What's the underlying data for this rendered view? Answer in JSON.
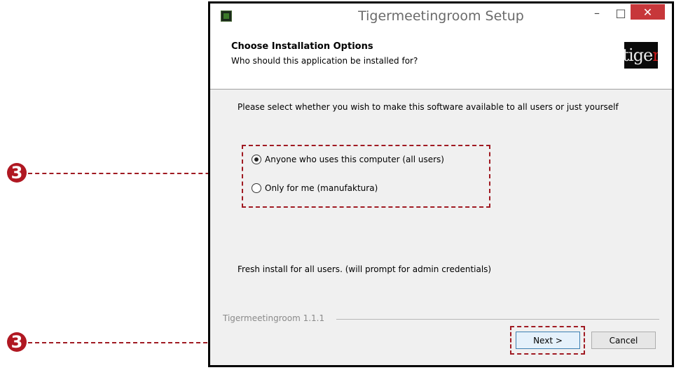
{
  "window": {
    "title": "Tigermeetingroom Setup",
    "controls": {
      "minimize": "–",
      "maximize": "□",
      "close": "✕"
    }
  },
  "header": {
    "title": "Choose Installation Options",
    "subtitle": "Who should this application be installed for?",
    "logo_text_main": "tige",
    "logo_text_accent": "r"
  },
  "body": {
    "prompt": "Please select whether you wish to make this software available to all users or just yourself",
    "options": [
      {
        "label": "Anyone who uses this computer (all users)",
        "selected": true
      },
      {
        "label": "Only for me (manufaktura)",
        "selected": false
      }
    ],
    "status": "Fresh install for all users. (will prompt for admin credentials)"
  },
  "footer": {
    "branding": "Tigermeetingroom 1.1.1",
    "next_label": "Next >",
    "cancel_label": "Cancel"
  },
  "annotations": {
    "callout_1": "3",
    "callout_2": "3",
    "color": "#a01a22"
  }
}
